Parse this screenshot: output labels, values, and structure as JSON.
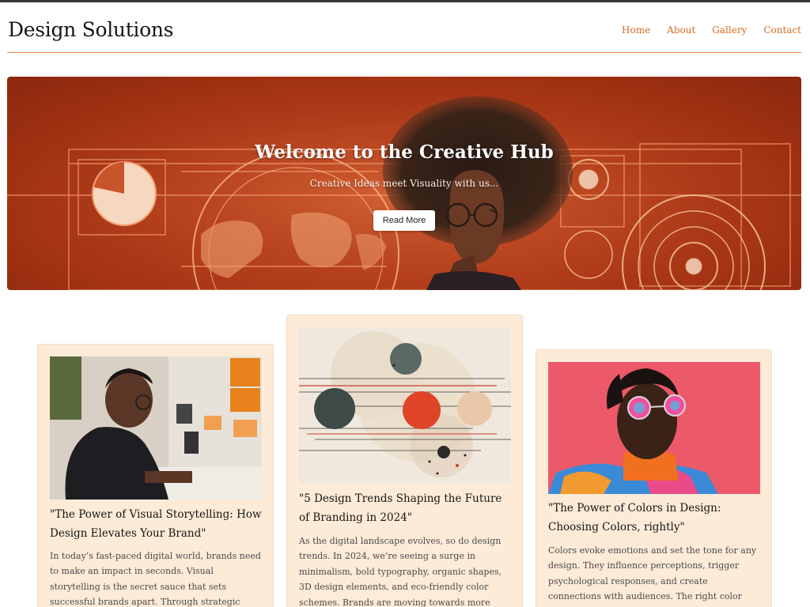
{
  "header": {
    "site_title": "Design Solutions",
    "nav": [
      "Home",
      "About",
      "Gallery",
      "Contact"
    ]
  },
  "hero": {
    "title": "Welcome to the Creative Hub",
    "subtitle": "Creative Ideas meet Visuality with us...",
    "button_label": "Read More"
  },
  "cards": [
    {
      "title": "\"The Power of Visual Storytelling: How Design Elevates Your Brand\"",
      "text": "In today’s fast-paced digital world, brands need to make an impact in seconds. Visual storytelling is the secret sauce that sets successful brands apart. Through strategic design elements like color, typography, and"
    },
    {
      "title": "\"5 Design Trends Shaping the Future of Branding in 2024\"",
      "text": "As the digital landscape evolves, so do design trends. In 2024, we’re seeing a surge in minimalism, bold typography, organic shapes, 3D design elements, and eco-friendly color schemes. Brands are moving towards more sustainable and visually clean designs,"
    },
    {
      "title": "\"The Power of Colors in Design: Choosing Colors, rightly\"",
      "text": "Colors evoke emotions and set the tone for any design. They influence perceptions, trigger psychological responses, and create connections with audiences. The right color choices enhance a brand's message and play"
    }
  ],
  "colors": {
    "accent": "#d86a20",
    "hero_bg": "#b8401c",
    "card_bg": "#fdebd8"
  }
}
